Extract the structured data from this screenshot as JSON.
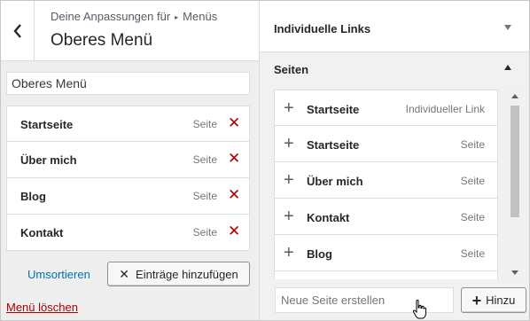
{
  "header": {
    "breadcrumb_prefix": "Deine Anpassungen für",
    "breadcrumb_sep": "▸",
    "breadcrumb_section": "Menüs",
    "title": "Oberes Menü"
  },
  "menu": {
    "name_value": "Oberes Menü",
    "items": [
      {
        "title": "Startseite",
        "type": "Seite"
      },
      {
        "title": "Über mich",
        "type": "Seite"
      },
      {
        "title": "Blog",
        "type": "Seite"
      },
      {
        "title": "Kontakt",
        "type": "Seite"
      }
    ],
    "reorder_label": "Umsortieren",
    "add_items_label": "Einträge hinzufügen",
    "delete_label": "Menü löschen"
  },
  "sidebar": {
    "custom_links_label": "Individuelle Links",
    "pages_label": "Seiten",
    "pages": [
      {
        "title": "Startseite",
        "type": "Individueller Link"
      },
      {
        "title": "Startseite",
        "type": "Seite"
      },
      {
        "title": "Über mich",
        "type": "Seite"
      },
      {
        "title": "Kontakt",
        "type": "Seite"
      },
      {
        "title": "Blog",
        "type": "Seite"
      },
      {
        "title": "",
        "type": ""
      }
    ],
    "new_page_placeholder": "Neue Seite erstellen",
    "add_label": "Hinzu"
  },
  "colors": {
    "link": "#0073aa",
    "delete": "#aa0000"
  }
}
